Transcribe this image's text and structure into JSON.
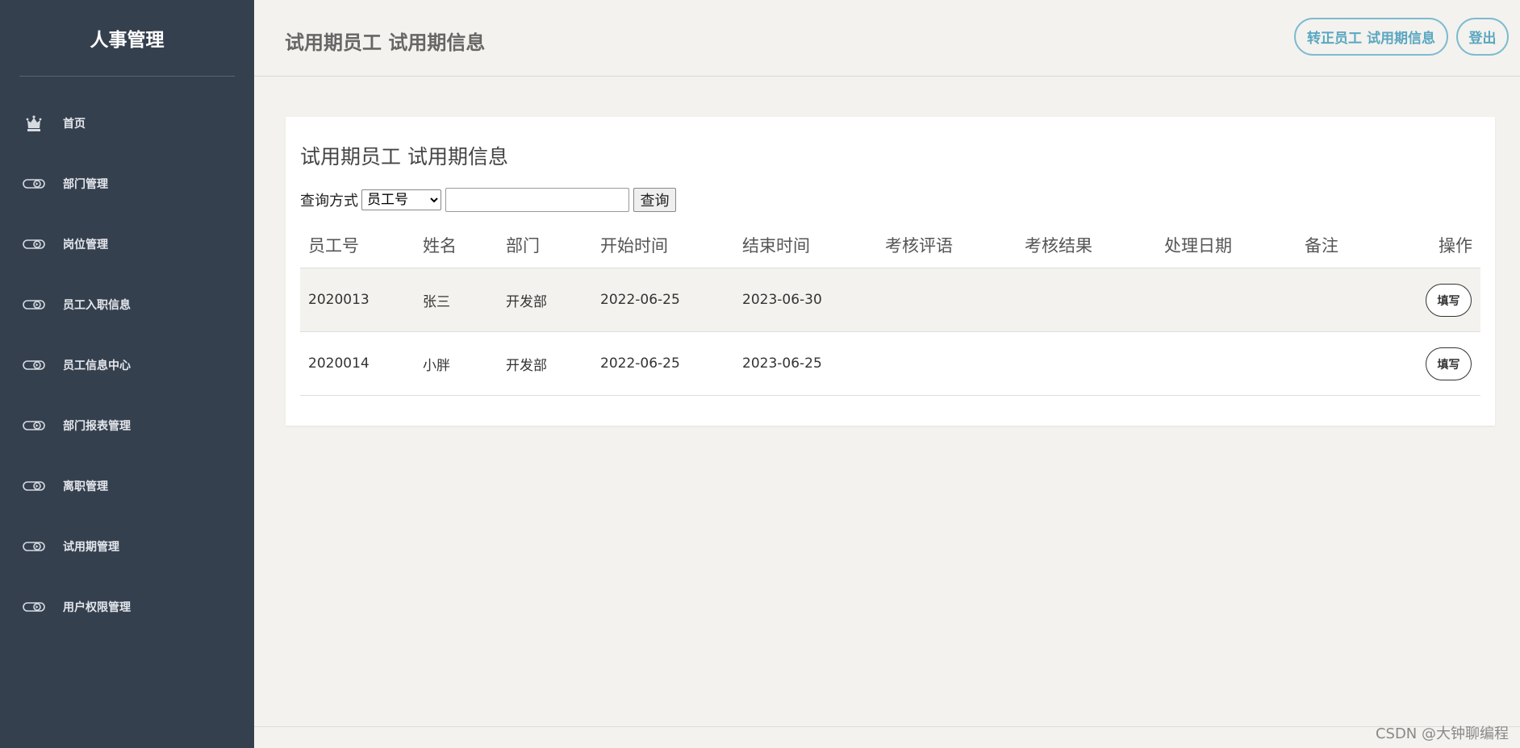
{
  "sidebar": {
    "brand": "人事管理",
    "items": [
      {
        "label": "首页",
        "icon": "crown-icon"
      },
      {
        "label": "部门管理",
        "icon": "toggle-arrow-icon"
      },
      {
        "label": "岗位管理",
        "icon": "toggle-arrow-icon"
      },
      {
        "label": "员工入职信息",
        "icon": "toggle-arrow-icon"
      },
      {
        "label": "员工信息中心",
        "icon": "toggle-arrow-icon"
      },
      {
        "label": "部门报表管理",
        "icon": "toggle-arrow-icon"
      },
      {
        "label": "离职管理",
        "icon": "toggle-arrow-icon"
      },
      {
        "label": "试用期管理",
        "icon": "toggle-arrow-icon"
      },
      {
        "label": "用户权限管理",
        "icon": "toggle-arrow-icon"
      }
    ]
  },
  "header": {
    "title": "试用期员工 试用期信息",
    "info_button": "转正员工 试用期信息",
    "logout_button": "登出"
  },
  "main": {
    "card_title": "试用期员工 试用期信息",
    "search": {
      "label": "查询方式",
      "select_value": "员工号",
      "input_value": "",
      "button": "查询"
    },
    "table": {
      "columns": [
        "员工号",
        "姓名",
        "部门",
        "开始时间",
        "结束时间",
        "考核评语",
        "考核结果",
        "处理日期",
        "备注",
        "操作"
      ],
      "rows": [
        {
          "id": "2020013",
          "name": "张三",
          "dept": "开发部",
          "start": "2022-06-25",
          "end": "2023-06-30",
          "comment": "",
          "result": "",
          "date": "",
          "note": "",
          "action": "填写"
        },
        {
          "id": "2020014",
          "name": "小胖",
          "dept": "开发部",
          "start": "2022-06-25",
          "end": "2023-06-25",
          "comment": "",
          "result": "",
          "date": "",
          "note": "",
          "action": "填写"
        }
      ]
    }
  },
  "watermark": "CSDN @大钟聊编程",
  "colors": {
    "sidebar_bg": "#35404f",
    "page_bg": "#f3f2ee",
    "accent": "#5aa7c1"
  }
}
